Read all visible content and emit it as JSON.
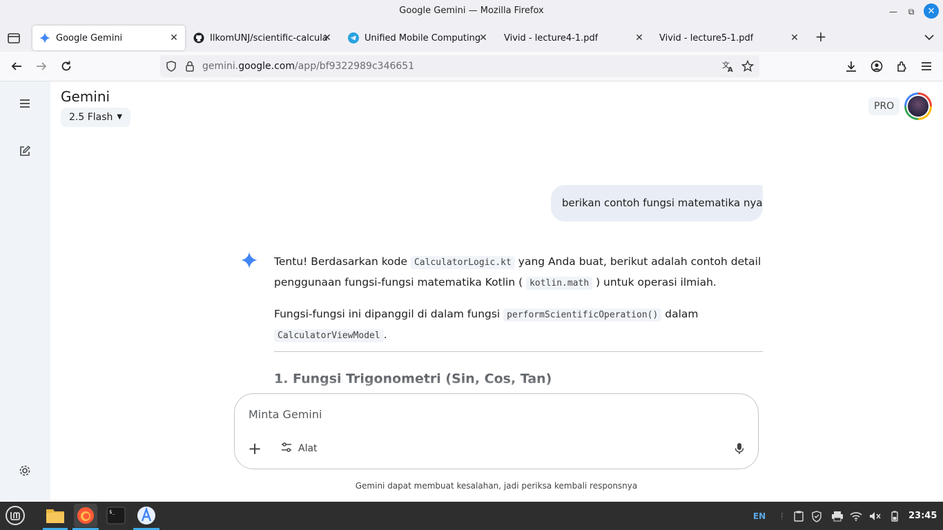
{
  "window": {
    "title": "Google Gemini — Mozilla Firefox"
  },
  "tabs": [
    {
      "label": "Google Gemini",
      "icon": "gemini-icon",
      "active": true
    },
    {
      "label": "IlkomUNJ/scientific-calculat",
      "icon": "github-icon",
      "active": false
    },
    {
      "label": "Unified Mobile Computing C",
      "icon": "telegram-icon",
      "active": false
    },
    {
      "label": "Vivid - lecture4-1.pdf",
      "icon": "",
      "active": false
    },
    {
      "label": "Vivid - lecture5-1.pdf",
      "icon": "",
      "active": false
    }
  ],
  "urlbar": {
    "prefix": "gemini.",
    "host": "google.com",
    "path": "/app/bf9322989c346651"
  },
  "app": {
    "brand": "Gemini",
    "model": "2.5 Flash",
    "plan_badge": "PRO"
  },
  "conversation": {
    "user_message": "berikan contoh fungsi matematika nya",
    "response": {
      "p1_a": "Tentu! Berdasarkan kode ",
      "p1_code1": "CalculatorLogic.kt",
      "p1_b": " yang Anda buat, berikut adalah contoh detail penggunaan fungsi-fungsi matematika Kotlin ( ",
      "p1_code2": "kotlin.math",
      "p1_c": " ) untuk operasi ilmiah.",
      "p2_a": "Fungsi-fungsi ini dipanggil di dalam fungsi ",
      "p2_code1": "performScientificOperation()",
      "p2_b": " dalam ",
      "p2_code2": "CalculatorViewModel",
      "p2_c": ".",
      "section_title": "1. Fungsi Trigonometri (Sin, Cos, Tan)"
    }
  },
  "composer": {
    "placeholder": "Minta Gemini",
    "tools_label": "Alat"
  },
  "disclaimer": "Gemini dapat membuat kesalahan, jadi periksa kembali responsnya",
  "taskbar": {
    "language": "EN",
    "clock": "23:45"
  },
  "colors": {
    "gemini_accent": "#4285f4",
    "user_bubble": "#e9eef6",
    "sidebar_bg": "#f0f4f9",
    "taskbar_bg": "#2e2e2e"
  }
}
